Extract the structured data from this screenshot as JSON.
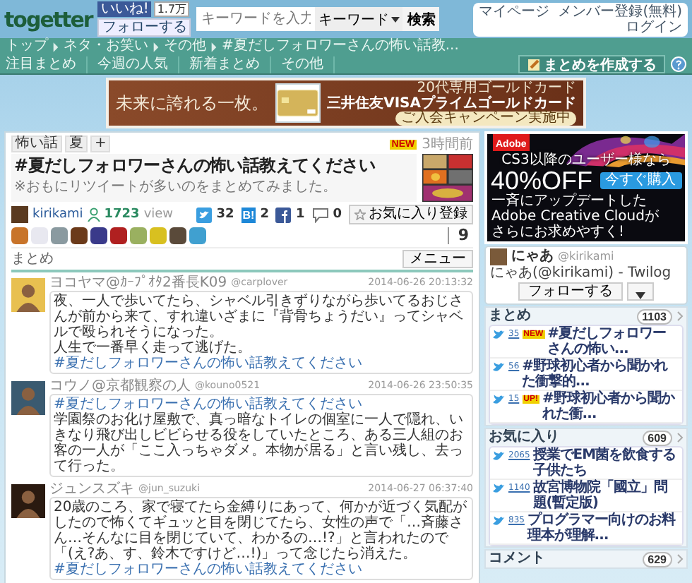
{
  "header": {
    "logo": "togetter",
    "like_button": "いいね!",
    "like_count": "1.7万",
    "follow_button": "フォローする",
    "search": {
      "placeholder": "キーワードを入力",
      "scope": "キーワード",
      "button": "検索"
    },
    "links": [
      "マイページ",
      "メンバー登録(無料)",
      "ログイン"
    ]
  },
  "nav": {
    "breadcrumbs": [
      "トップ",
      "ネタ・お笑い",
      "その他",
      "#夏だしフォロワーさんの怖い話教..."
    ],
    "links": [
      "注目まとめ",
      "今週の人気",
      "新着まとめ",
      "その他"
    ],
    "create_button": "まとめを作成する"
  },
  "top_ad": {
    "tagline": "未来に誇れる一枚。",
    "note": "20代専用ゴールドカード",
    "product": "三井住友VISAプライムゴールドカード",
    "cta": "ご入会キャンペーン実施中"
  },
  "matome": {
    "tags": [
      "怖い話",
      "夏",
      "+"
    ],
    "badge": "NEW",
    "age": "3時間前",
    "title": "#夏だしフォロワーさんの怖い話教えてください",
    "description": "※おもにリツイートが多いのをまとめてみました。",
    "author": "kirikami",
    "views": "1723",
    "views_label": "view",
    "shares": [
      {
        "kind": "twitter",
        "count": "32"
      },
      {
        "kind": "hatena",
        "label": "B!",
        "count": "2"
      },
      {
        "kind": "facebook",
        "count": "1"
      },
      {
        "kind": "comment",
        "count": "0"
      }
    ],
    "favorite_button": "お気に入り登録",
    "fav_count": "9",
    "section_title": "まとめ",
    "menu_button": "メニュー"
  },
  "tweets": [
    {
      "name": "ヨコヤマ@ｶｰﾌﾟｵﾀ2番長K09",
      "handle": "@carplover",
      "time": "2014-06-26 20:13:32",
      "lines": [
        [
          {
            "kind": "text",
            "text": "夜、一人で歩いてたら、シャベル引きずりながら歩いてるおじさんが前から来て、すれ違いざまに『背骨ちょうだい』ってシャベルで殴られそうになった。"
          }
        ],
        [
          {
            "kind": "text",
            "text": "人生で一番早く走って逃げた。"
          }
        ],
        [
          {
            "kind": "hashtag",
            "text": "#夏だしフォロワーさんの怖い話教えてください"
          }
        ]
      ]
    },
    {
      "name": "コウノ@京都観察の人",
      "handle": "@kouno0521",
      "time": "2014-06-26 23:50:35",
      "lines": [
        [
          {
            "kind": "hashtag",
            "text": "#夏だしフォロワーさんの怖い話教えてください"
          }
        ],
        [
          {
            "kind": "text",
            "text": "学園祭のお化け屋敷で、真っ暗なトイレの個室に一人で隠れ、いきなり飛び出しビビらせる役をしていたところ、ある三人組のお客の一人が「ここ入っちゃダメ。本物が居る」と言い残し、去って行った。"
          }
        ]
      ]
    },
    {
      "name": "ジュンスズキ",
      "handle": "@jun_suzuki",
      "time": "2014-06-27 06:37:40",
      "lines": [
        [
          {
            "kind": "text",
            "text": "20歳のころ、家で寝てたら金縛りにあって、何かが近づく気配がしたので怖くてギュッと目を閉じてたら、女性の声で「…斉藤さん…そんなに目を閉じていて、わかるの…!?」と言われたので「(え?あ、す、鈴木ですけど…!)」って念じたら消えた。"
          },
          {
            "kind": "hashtag",
            "text": "#夏だしフォロワーさんの怖い話教えてください"
          }
        ]
      ]
    }
  ],
  "side_ad": {
    "brand": "Adobe",
    "lead": "CS3以降のユーザー様なら",
    "offer": "40%OFF",
    "body": [
      "一斉にアップデートした",
      "Adobe Creative Cloudが",
      "さらにお求めやすく!"
    ],
    "button": "今すぐ購入"
  },
  "profile": {
    "name": "にゃあ",
    "handle": "@kirikami",
    "twilog": "にゃあ(@kirikami) - Twilog",
    "follow_button": "フォローする"
  },
  "sections": [
    {
      "title": "まとめ",
      "count": "1103",
      "items": [
        {
          "count": "35",
          "badge": "NEW",
          "title": "#夏だしフォロワーさんの怖い…"
        },
        {
          "count": "56",
          "title": "#野球初心者から聞かれた衝撃的…"
        },
        {
          "count": "15",
          "badge": "UP!",
          "title": "#野球初心者から聞かれた衝…"
        }
      ]
    },
    {
      "title": "お気に入り",
      "count": "609",
      "items": [
        {
          "count": "2065",
          "title": "授業でEM菌を飲食する子供たち"
        },
        {
          "count": "1140",
          "title": "故宮博物院「國立」問題(暫定版)"
        },
        {
          "count": "835",
          "title": "プログラマー向けのお料理本が理解…"
        }
      ]
    },
    {
      "title": "コメント",
      "count": "629"
    }
  ]
}
